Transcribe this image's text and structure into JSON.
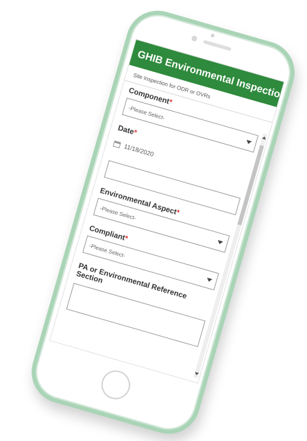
{
  "app": {
    "title": "GHIB Environmental Inspection",
    "subtitle": "Site Inspection for ODR or OVRs"
  },
  "fields": [
    {
      "label": "Component",
      "required_mark": "*",
      "value": "-Please Select-",
      "type": "select"
    },
    {
      "label": "Date",
      "required_mark": "*",
      "value": "11/18/2020",
      "type": "date"
    },
    {
      "label": "Environmental Aspect",
      "required_mark": "*",
      "value": "-Please Select-",
      "type": "select"
    },
    {
      "label": "Compliant",
      "required_mark": "*",
      "value": "-Please Select-",
      "type": "select"
    },
    {
      "label": "PA or Environmental Reference Section",
      "required_mark": "",
      "value": "",
      "type": "text"
    }
  ],
  "icons": {
    "calendar": "calendar-icon",
    "dropdown": "chevron-down-icon"
  },
  "colors": {
    "header": "#2e8a3c",
    "phone_frame": "#a9d4b6",
    "required": "#e03a3a"
  }
}
